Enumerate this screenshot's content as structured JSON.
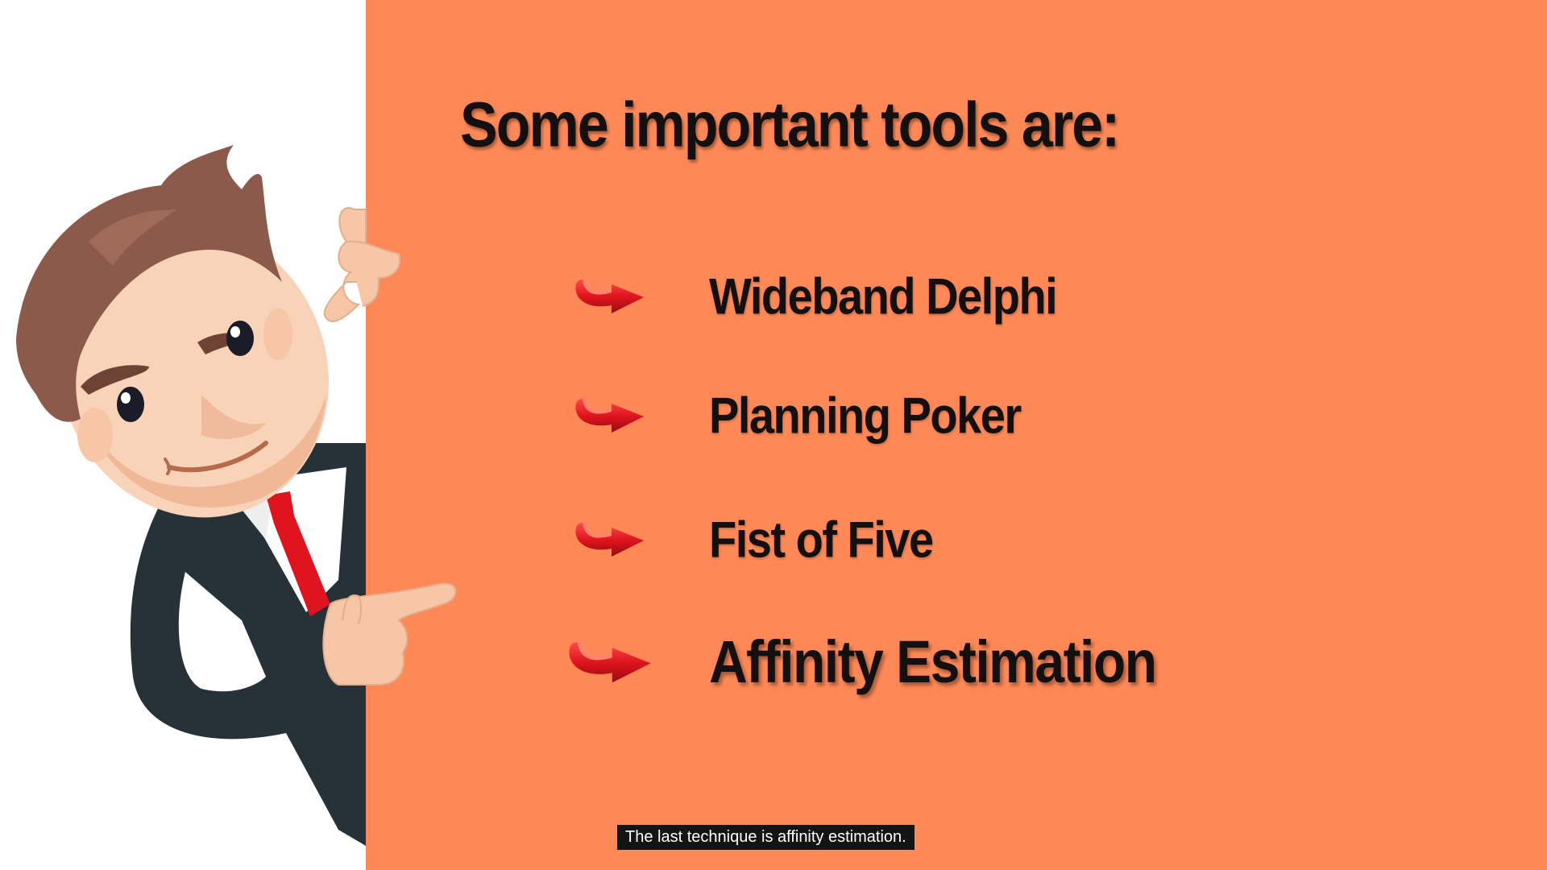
{
  "slide": {
    "title": "Some important tools are:",
    "tools": [
      {
        "label": "Wideband Delphi",
        "icon": "curved-red-arrow-icon"
      },
      {
        "label": "Planning Poker",
        "icon": "curved-red-arrow-icon"
      },
      {
        "label": "Fist of Five",
        "icon": "curved-red-arrow-icon"
      },
      {
        "label": "Affinity Estimation",
        "icon": "curved-red-arrow-icon"
      }
    ],
    "highlighted_item": "Affinity Estimation"
  },
  "illustration": {
    "subject": "cartoon-businessman-pointing-icon"
  },
  "caption": {
    "text": "The last technique is affinity estimation."
  },
  "colors": {
    "panel_background": "#fe8856",
    "left_background": "#ffffff",
    "text": "#141010",
    "arrow_red": "#e0141e",
    "caption_background": "#141414",
    "caption_text": "#ffffff"
  }
}
